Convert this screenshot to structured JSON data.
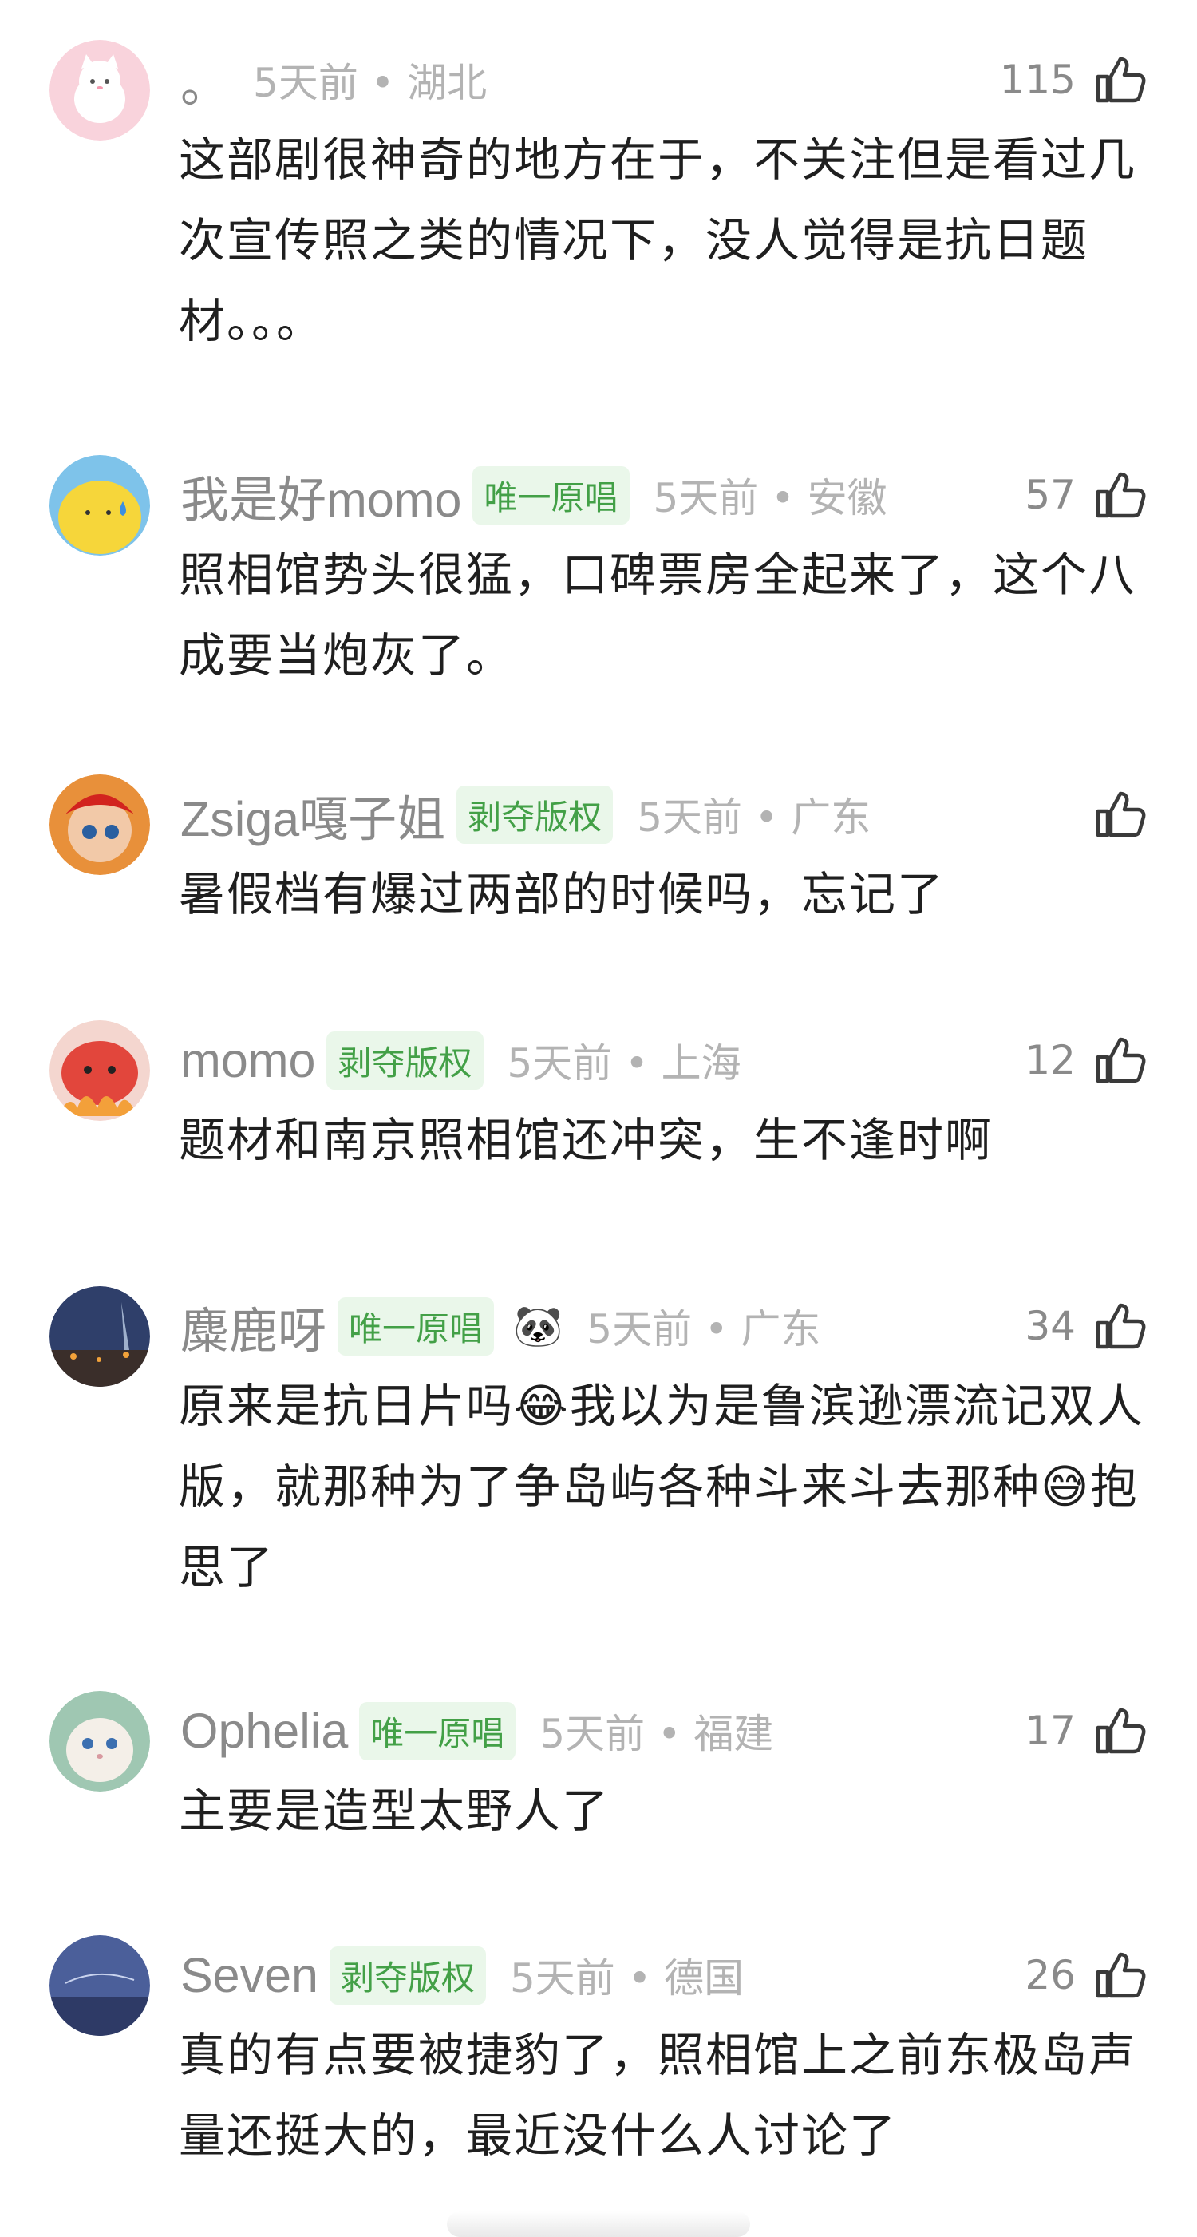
{
  "comments": [
    {
      "user": "。",
      "badge": "",
      "emoji_badge": "",
      "time_loc": "5天前 • 湖北",
      "likes": "115",
      "text": "这部剧很神奇的地方在于，不关注但是看过几次宣传照之类的情况下，没人觉得是抗日题材。。。"
    },
    {
      "user": "我是好momo",
      "badge": "唯一原唱",
      "emoji_badge": "",
      "time_loc": "5天前 • 安徽",
      "likes": "57",
      "text": "照相馆势头很猛，口碑票房全起来了，这个八成要当炮灰了。"
    },
    {
      "user": "Zsiga嘎子姐",
      "badge": "剥夺版权",
      "emoji_badge": "",
      "time_loc": "5天前 • 广东",
      "likes": "",
      "text": "暑假档有爆过两部的时候吗，忘记了"
    },
    {
      "user": "momo",
      "badge": "剥夺版权",
      "emoji_badge": "",
      "time_loc": "5天前 • 上海",
      "likes": "12",
      "text": "题材和南京照相馆还冲突，生不逢时啊"
    },
    {
      "user": "麋鹿呀",
      "badge": "唯一原唱",
      "emoji_badge": "🐼",
      "time_loc": "5天前 • 广东",
      "likes": "34",
      "text": "原来是抗日片吗😂我以为是鲁滨逊漂流记双人版，就那种为了争岛屿各种斗来斗去那种😅抱思了"
    },
    {
      "user": "Ophelia",
      "badge": "唯一原唱",
      "emoji_badge": "",
      "time_loc": "5天前 • 福建",
      "likes": "17",
      "text": "主要是造型太野人了"
    },
    {
      "user": "Seven",
      "badge": "剥夺版权",
      "emoji_badge": "",
      "time_loc": "5天前 • 德国",
      "likes": "26",
      "text": "真的有点要被捷豹了，照相馆上之前东极岛声量还挺大的，最近没什么人讨论了"
    }
  ],
  "colors": {
    "badge_text": "#43a047",
    "badge_bg": "#eaf7ea",
    "name": "#8a8a8a",
    "meta": "#b3b3b3"
  },
  "icons": [
    "like-thumb-icon"
  ]
}
